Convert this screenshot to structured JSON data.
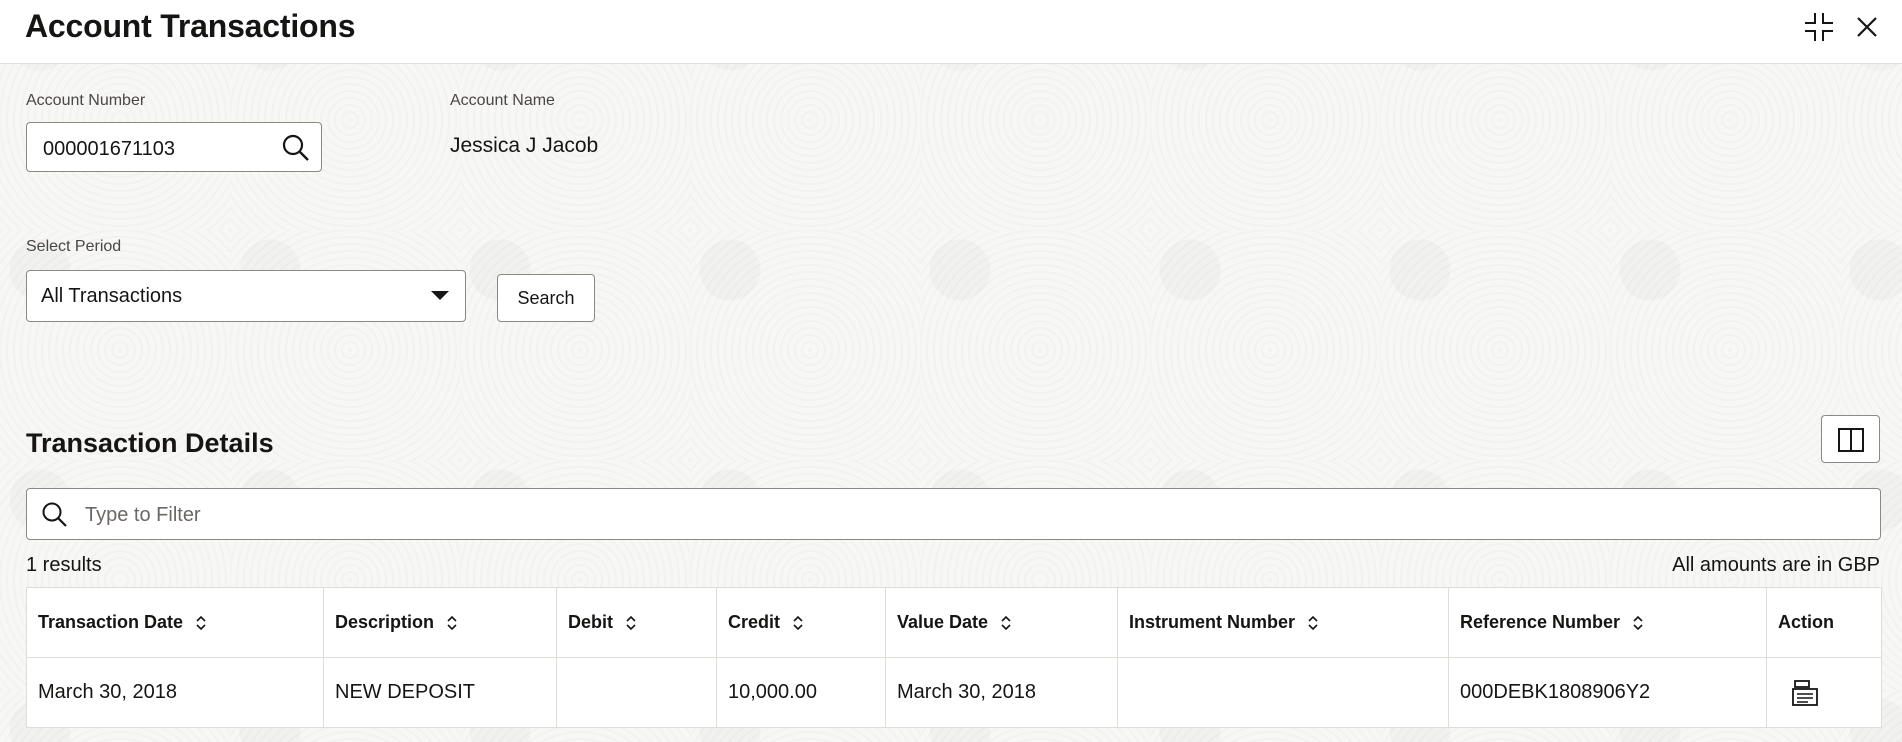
{
  "header": {
    "title": "Account Transactions",
    "minimize_icon": "minimize-icon",
    "close_icon": "close-icon"
  },
  "form": {
    "account_number_label": "Account Number",
    "account_number_value": "000001671103",
    "account_name_label": "Account Name",
    "account_name_value": "Jessica J Jacob",
    "period_label": "Select Period",
    "period_value": "All Transactions",
    "search_label": "Search"
  },
  "details": {
    "title": "Transaction Details",
    "filter_placeholder": "Type to Filter",
    "results_count": "1 results",
    "currency_note": "All amounts are in GBP",
    "columns": [
      "Transaction Date",
      "Description",
      "Debit",
      "Credit",
      "Value Date",
      "Instrument Number",
      "Reference Number",
      "Action"
    ],
    "rows": [
      {
        "transaction_date": "March 30, 2018",
        "description": "NEW DEPOSIT",
        "debit": "",
        "credit": "10,000.00",
        "value_date": "March 30, 2018",
        "instrument_number": "",
        "reference_number": "000DEBK1808906Y2",
        "action_icon": "view-details-icon"
      }
    ]
  }
}
